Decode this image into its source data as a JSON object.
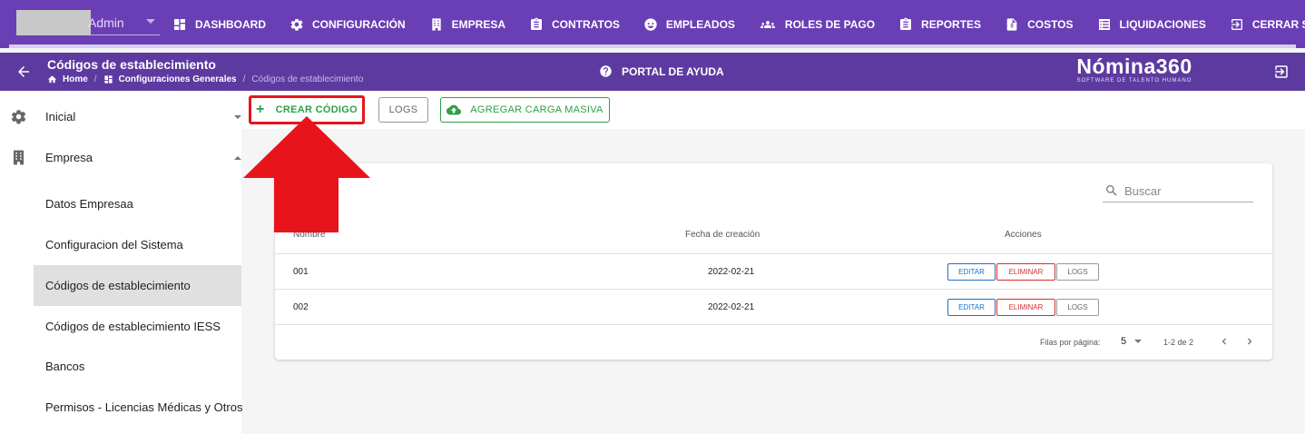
{
  "topnav": {
    "user_name": "Admin",
    "items": [
      {
        "label": "DASHBOARD",
        "icon": "dashboard-icon"
      },
      {
        "label": "CONFIGURACIÓN",
        "icon": "gear-icon"
      },
      {
        "label": "EMPRESA",
        "icon": "building-icon"
      },
      {
        "label": "CONTRATOS",
        "icon": "clipboard-icon"
      },
      {
        "label": "EMPLEADOS",
        "icon": "face-icon"
      },
      {
        "label": "ROLES DE PAGO",
        "icon": "group-icon"
      },
      {
        "label": "REPORTES",
        "icon": "clipboard-icon"
      },
      {
        "label": "COSTOS",
        "icon": "invoice-icon"
      },
      {
        "label": "LIQUIDACIONES",
        "icon": "list-icon"
      },
      {
        "label": "CERRAR SESIÓN",
        "icon": "logout-icon"
      }
    ]
  },
  "subheader": {
    "title": "Códigos de establecimiento",
    "breadcrumb": [
      "Home",
      "Configuraciones Generales",
      "Códigos de establecimiento"
    ],
    "help_label": "PORTAL DE AYUDA",
    "brand_name": "Nómina360",
    "brand_tagline": "SOFTWARE DE TALENTO HUMANO"
  },
  "sidebar": {
    "groups": [
      {
        "label": "Inicial",
        "icon": "gear-icon"
      },
      {
        "label": "Empresa",
        "icon": "building-icon"
      }
    ],
    "items": [
      "Datos Empresaa",
      "Configuracion del Sistema",
      "Códigos de establecimiento",
      "Códigos de establecimiento IESS",
      "Bancos",
      "Permisos - Licencias Médicas y Otros"
    ]
  },
  "actions": {
    "create_label": "CREAR CÓDIGO",
    "logs_label": "LOGS",
    "bulk_label": "AGREGAR CARGA MASIVA"
  },
  "table": {
    "search_placeholder": "Buscar",
    "columns": [
      "Nombre",
      "Fecha de creación",
      "Acciones"
    ],
    "rows": [
      {
        "nombre": "001",
        "fecha": "2022-02-21"
      },
      {
        "nombre": "002",
        "fecha": "2022-02-21"
      }
    ],
    "row_buttons": {
      "edit": "EDITAR",
      "delete": "ELIMINAR",
      "logs": "LOGS"
    },
    "pagination": {
      "rows_label": "Filas por página:",
      "rows_per_page": "5",
      "range": "1-2 de 2"
    }
  },
  "colors": {
    "primary": "#6a3fb5",
    "primary_dark": "#5d3aa0",
    "success": "#2e9e47",
    "danger": "#d32f2f",
    "info": "#1a73c8",
    "highlight": "#e8141c"
  }
}
